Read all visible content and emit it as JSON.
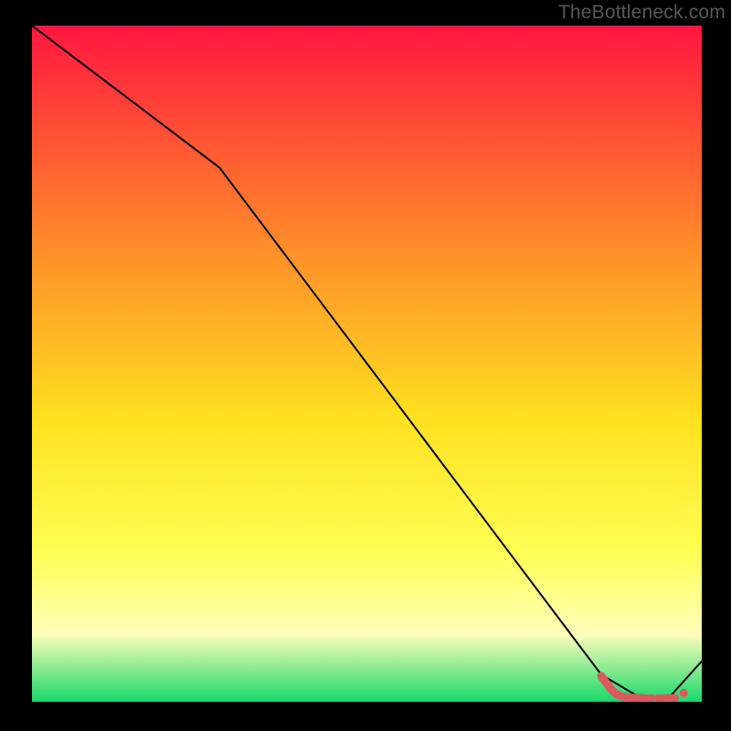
{
  "watermark": "TheBottleneck.com",
  "chart_data": {
    "type": "line",
    "title": "",
    "xlabel": "",
    "ylabel": "",
    "xlim": [
      0,
      100
    ],
    "ylim": [
      0,
      100
    ],
    "gradient_colors": {
      "top": "#ff163f",
      "upper_mid": "#ff8a2a",
      "mid": "#ffe020",
      "lower_mid": "#ffff55",
      "pale": "#ffffbb",
      "bottom": "#18d86a"
    },
    "series": [
      {
        "name": "bottleneck-curve",
        "color": "#000000",
        "x": [
          0,
          4,
          28,
          85,
          91,
          95,
          100
        ],
        "y": [
          100,
          97,
          79,
          4,
          0.5,
          0.5,
          6
        ]
      }
    ],
    "markers": {
      "name": "target-range",
      "color": "#d9595d",
      "points": [
        {
          "x": 85.0,
          "y": 3.8
        },
        {
          "x": 85.6,
          "y": 3.0
        },
        {
          "x": 86.2,
          "y": 2.2
        },
        {
          "x": 86.8,
          "y": 1.5
        },
        {
          "x": 87.5,
          "y": 1.0
        },
        {
          "x": 88.5,
          "y": 0.7
        },
        {
          "x": 89.5,
          "y": 0.6
        },
        {
          "x": 91.0,
          "y": 0.55
        },
        {
          "x": 92.0,
          "y": 0.55
        },
        {
          "x": 94.0,
          "y": 0.55
        },
        {
          "x": 95.5,
          "y": 0.6
        }
      ]
    }
  }
}
